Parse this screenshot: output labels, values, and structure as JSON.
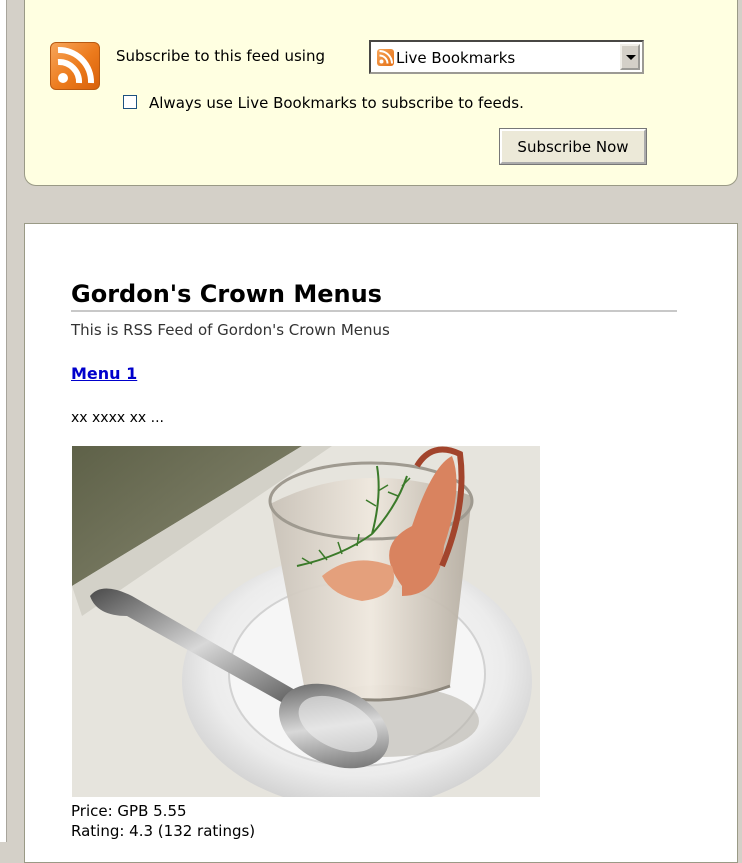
{
  "subscribe": {
    "label": "Subscribe to this feed using",
    "reader_selected": "Live Bookmarks",
    "always_use_label": "Always use Live Bookmarks to subscribe to feeds.",
    "always_use_checked": false,
    "button_label": "Subscribe Now",
    "feed_icon": "rss-feed-icon",
    "accent_color": "#ec7a1c"
  },
  "feed": {
    "title": "Gordon's Crown Menus",
    "subtitle": "This is RSS Feed of Gordon's Crown Menus"
  },
  "items": [
    {
      "title": "Menu 1",
      "description": "xx xxxx xx ...",
      "image": "shrimp-cocktail-glass-on-plate-with-spoon",
      "price": "Price: GPB 5.55",
      "rating": "Rating: 4.3 (132 ratings)"
    }
  ]
}
